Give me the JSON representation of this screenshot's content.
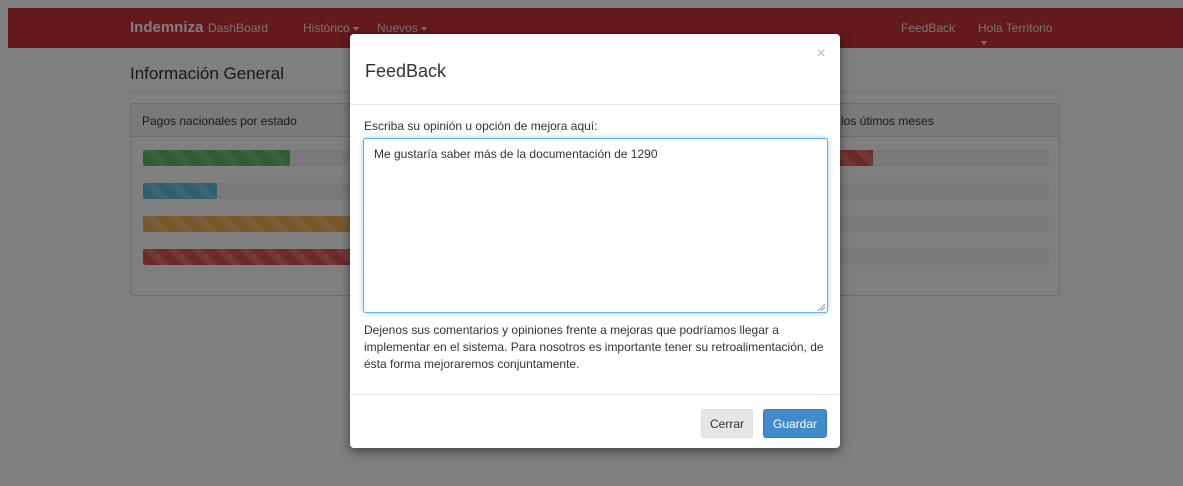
{
  "navbar": {
    "brand": "Indemniza",
    "links": [
      {
        "label": "DashBoard",
        "dropdown": false
      },
      {
        "label": "Histórico",
        "dropdown": true
      },
      {
        "label": "Nuevos",
        "dropdown": true
      }
    ],
    "right_links": [
      {
        "label": "FeedBack",
        "dropdown": false
      },
      {
        "label": "Hola Territorio",
        "dropdown": true
      }
    ]
  },
  "main": {
    "section_title": "Información General",
    "panel_left_heading": "Pagos nacionales por estado",
    "panel_right_heading": "los útimos meses",
    "left_bars": [
      {
        "color": "#5cb85c",
        "fraction": 0.32
      },
      {
        "color": "#5bc0de",
        "fraction": 0.16
      },
      {
        "color": "#f0ad4e",
        "fraction": 1.0
      },
      {
        "color": "#d9534f",
        "fraction": 1.0
      }
    ],
    "right_bars": [
      [
        {
          "color": "#f0ad4e",
          "fraction": 0.38
        },
        {
          "color": "#d9534f",
          "fraction": 0.21
        }
      ],
      [
        {
          "color": "#f0ad4e",
          "fraction": 0.18
        },
        {
          "color": "#d9534f",
          "fraction": 0.21
        }
      ],
      [
        {
          "color": "#d9534f",
          "fraction": 0.18
        }
      ],
      []
    ]
  },
  "modal": {
    "title": "FeedBack",
    "close_symbol": "×",
    "field_label": "Escriba su opinión u opción de mejora aquí:",
    "textarea_value": "Me gustaría saber más de la documentación de 1290",
    "help_text": "Dejenos sus comentarios y opiniones frente a mejoras que podríamos llegar a implementar en el sistema. Para nosotros es importante tener su retroalimentación, de ésta forma mejoraremos conjuntamente.",
    "cancel_label": "Cerrar",
    "save_label": "Guardar"
  },
  "colors": {
    "navbar": "#c9353b",
    "primary": "#428bca",
    "success": "#5cb85c",
    "info": "#5bc0de",
    "warning": "#f0ad4e",
    "danger": "#d9534f"
  }
}
